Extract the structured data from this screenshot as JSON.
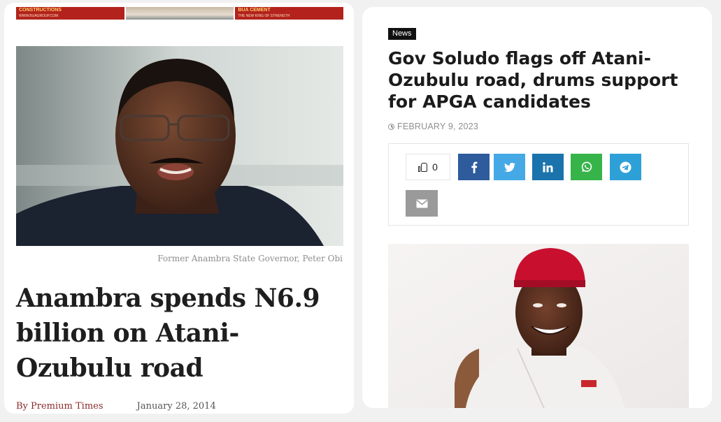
{
  "left_article": {
    "banner": {
      "left_text": "CONSTRUCTIONS",
      "left_sub": "WWW.BUAGROUP.COM",
      "right_text": "BUA CEMENT",
      "right_sub": "THE NEW KING OF STRENGTH"
    },
    "image_caption": "Former Anambra State Governor, Peter Obi",
    "headline": "Anambra spends N6.9 billion on Atani-Ozubulu road",
    "byline_author": "By Premium Times",
    "byline_date": "January 28, 2014"
  },
  "right_article": {
    "category": "News",
    "headline": "Gov Soludo flags off Atani-Ozubulu road, drums support for APGA candidates",
    "date": "FEBRUARY 9, 2023",
    "like_count": "0",
    "share_buttons": [
      {
        "name": "facebook",
        "icon": "facebook-icon",
        "color": "#2d5b9c"
      },
      {
        "name": "twitter",
        "icon": "twitter-icon",
        "color": "#45a9e6"
      },
      {
        "name": "linkedin",
        "icon": "linkedin-icon",
        "color": "#1a73ac"
      },
      {
        "name": "whatsapp",
        "icon": "whatsapp-icon",
        "color": "#36b44a"
      },
      {
        "name": "telegram",
        "icon": "telegram-icon",
        "color": "#2ea0d8"
      },
      {
        "name": "email",
        "icon": "envelope-icon",
        "color": "#9a9a9a"
      }
    ]
  }
}
